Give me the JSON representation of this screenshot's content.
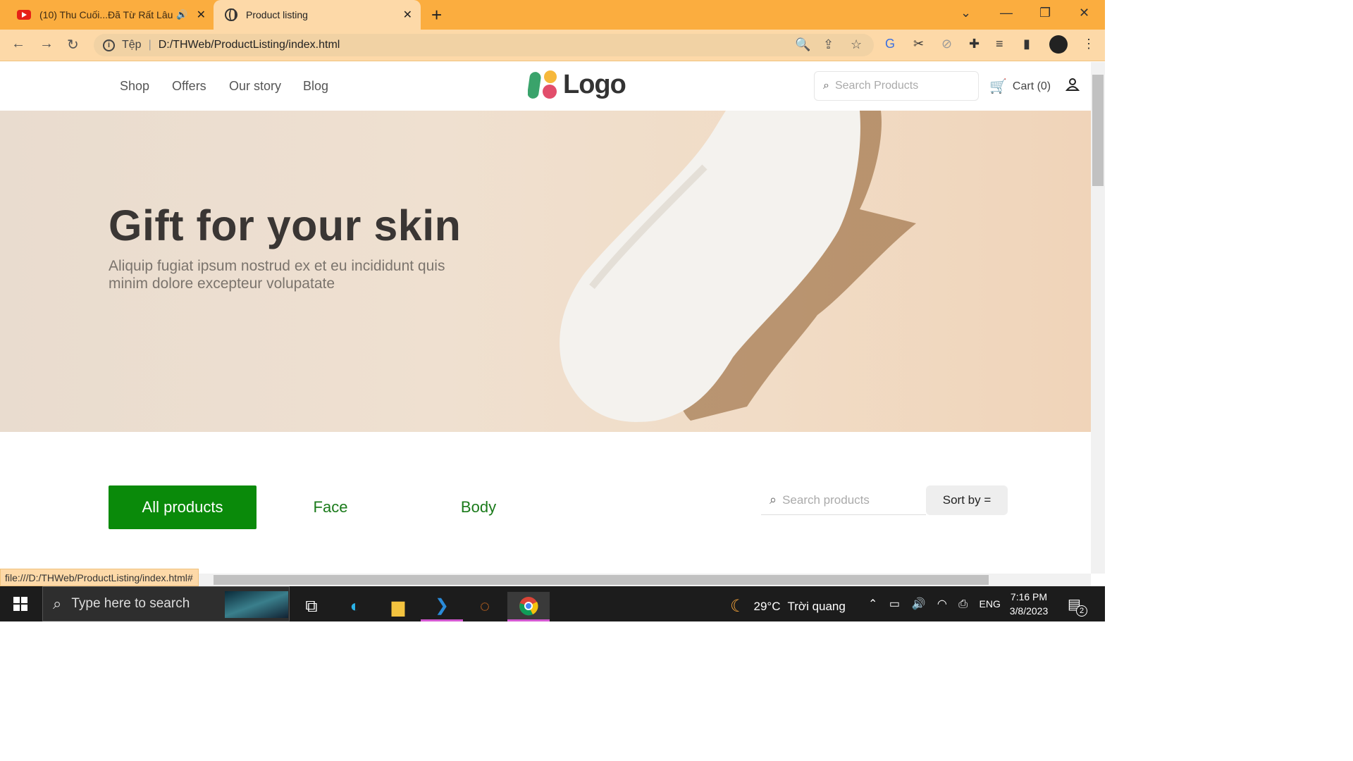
{
  "browser": {
    "tabs": [
      {
        "title": "(10) Thu Cuối...Đã Từ Rất Lâu",
        "icon": "youtube-icon",
        "audio": true
      },
      {
        "title": "Product listing",
        "icon": "globe-icon",
        "active": true
      }
    ],
    "address": {
      "scheme_label": "Tệp",
      "url": "D:/THWeb/ProductListing/index.html"
    },
    "status_url": "file:///D:/THWeb/ProductListing/index.html#"
  },
  "site": {
    "nav": [
      "Shop",
      "Offers",
      "Our story",
      "Blog"
    ],
    "logo_text": "Logo",
    "search_placeholder": "Search Products",
    "cart_label": "Cart (0)"
  },
  "hero": {
    "title": "Gift for your skin",
    "subtitle": "Aliquip fugiat ipsum nostrud ex et eu incididunt quis minim dolore excepteur volupatate"
  },
  "filters": {
    "tabs": [
      "All products",
      "Face",
      "Body"
    ],
    "active": "All products",
    "search_placeholder": "Search products",
    "sort_label": "Sort by ="
  },
  "taskbar": {
    "search_placeholder": "Type here to search",
    "weather": {
      "temp": "29°C",
      "desc": "Trời quang"
    },
    "lang": "ENG",
    "time": "7:16 PM",
    "date": "3/8/2023",
    "notification_count": "2"
  },
  "colors": {
    "browser_frame": "#fbad3f",
    "toolbar": "#fdd9a8",
    "accent_green": "#0a8a0a"
  }
}
